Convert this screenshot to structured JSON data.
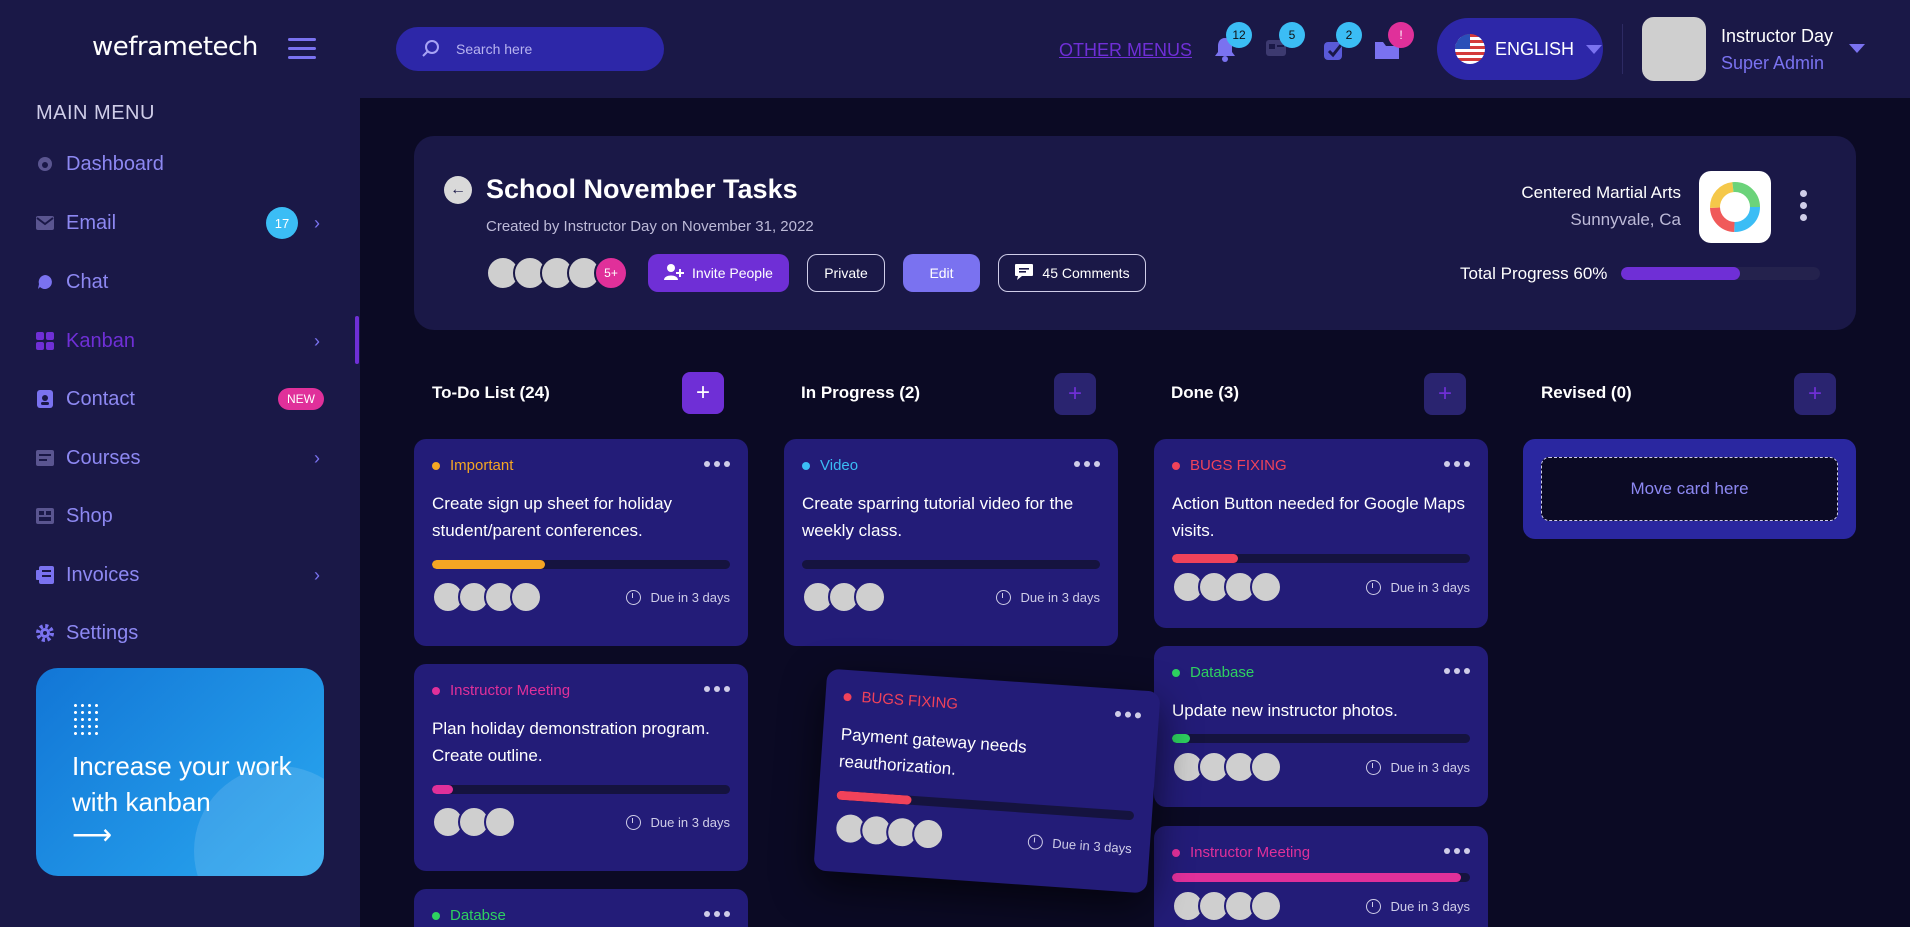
{
  "brand": "weframetech",
  "sidebar": {
    "menu_title": "MAIN MENU",
    "items": [
      {
        "label": "Dashboard"
      },
      {
        "label": "Email",
        "badge": "17"
      },
      {
        "label": "Chat"
      },
      {
        "label": "Kanban"
      },
      {
        "label": "Contact",
        "badge": "NEW"
      },
      {
        "label": "Courses"
      },
      {
        "label": "Shop"
      },
      {
        "label": "Invoices"
      },
      {
        "label": "Settings"
      }
    ],
    "active_item": "Kanban",
    "promo": {
      "text": "Increase your work with kanban",
      "arrow": "⟶"
    }
  },
  "topbar": {
    "search_placeholder": "Search here",
    "other_menus": "OTHER MENUS",
    "badges": {
      "notifications": "12",
      "messages": "5",
      "tasks": "2",
      "folder": "!"
    },
    "language": "ENGLISH",
    "user": {
      "name": "Instructor Day",
      "role": "Super Admin"
    }
  },
  "project": {
    "title": "School November Tasks",
    "subtitle": "Created by Instructor Day on November 31, 2022",
    "more_members": "5+",
    "invite_label": "Invite People",
    "private_label": "Private",
    "edit_label": "Edit",
    "comments_label": "45 Comments",
    "school_name": "Centered Martial Arts",
    "school_city": "Sunnyvale, Ca",
    "progress_label": "Total Progress 60%",
    "progress": 0.6
  },
  "columns": [
    {
      "title": "To-Do List (24)"
    },
    {
      "title": "In Progress (2)"
    },
    {
      "title": "Done (3)"
    },
    {
      "title": "Revised (0)"
    }
  ],
  "cards": {
    "todo": [
      {
        "tag": "Important",
        "tag_color": "#f5a623",
        "title": "Create sign up sheet for holiday student/parent conferences.",
        "progress": 0.38,
        "bar_color": "#f5a623",
        "due": "Due in 3 days"
      },
      {
        "tag": "Instructor Meeting",
        "tag_color": "#e0309a",
        "title": "Plan holiday demonstration program. Create outline.",
        "progress": 0.07,
        "bar_color": "#e0309a",
        "due": "Due in 3 days"
      },
      {
        "tag": "Databse",
        "tag_color": "#2ed160"
      }
    ],
    "inprogress": [
      {
        "tag": "Video",
        "tag_color": "#3bbdf5",
        "title": "Create sparring tutorial video for the weekly class.",
        "progress": 0.0,
        "bar_color": "#3bbdf5",
        "due": "Due in 3 days"
      }
    ],
    "dragging": {
      "tag": "BUGS FIXING",
      "tag_color": "#f0425a",
      "title": "Payment gateway needs reauthorization.",
      "progress": 0.25,
      "bar_color": "#f0425a",
      "due": "Due in 3 days"
    },
    "done": [
      {
        "tag": "BUGS FIXING",
        "tag_color": "#f0425a",
        "title": "Action Button needed for Google Maps visits.",
        "progress": 0.22,
        "bar_color": "#f0425a",
        "due": "Due in 3 days"
      },
      {
        "tag": "Database",
        "tag_color": "#2ed160",
        "title": "Update new instructor photos.",
        "progress": 0.06,
        "bar_color": "#2ed160",
        "due": "Due in 3 days"
      },
      {
        "tag": "Instructor Meeting",
        "tag_color": "#e0309a",
        "progress": 0.97,
        "bar_color": "#e0309a",
        "due": "Due in 3 days"
      }
    ],
    "revised_drop_label": "Move card here"
  }
}
